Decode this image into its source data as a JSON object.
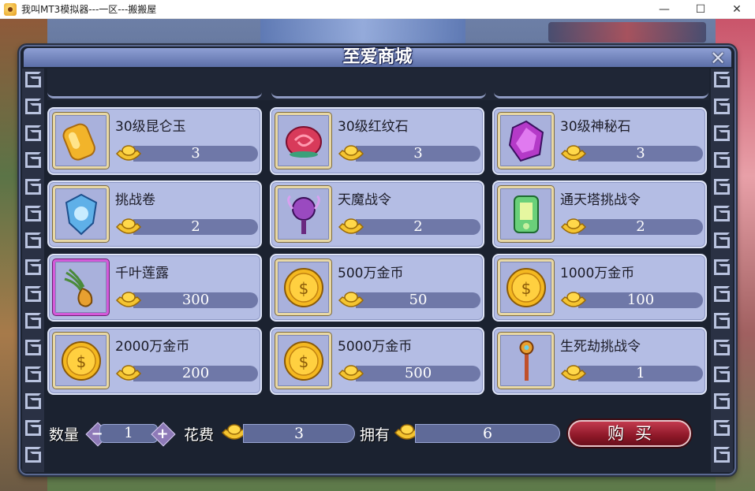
{
  "window": {
    "title": "我叫MT3模拟器---一区---搬搬屋",
    "controls": {
      "minimize": "—",
      "maximize": "☐",
      "close": "✕"
    }
  },
  "shop": {
    "title": "至爱商城",
    "close_label": "✕",
    "items": [
      {
        "name": "30级昆仑玉",
        "price": "3",
        "icon": "kunlun-jade-icon"
      },
      {
        "name": "30级红纹石",
        "price": "3",
        "icon": "red-stone-icon"
      },
      {
        "name": "30级神秘石",
        "price": "3",
        "icon": "mystery-stone-icon"
      },
      {
        "name": "挑战卷",
        "price": "2",
        "icon": "challenge-scroll-icon"
      },
      {
        "name": "天魔战令",
        "price": "2",
        "icon": "demon-token-icon"
      },
      {
        "name": "通天塔挑战令",
        "price": "2",
        "icon": "tower-token-icon"
      },
      {
        "name": "千叶莲露",
        "price": "300",
        "icon": "lotus-dew-icon"
      },
      {
        "name": "500万金币",
        "price": "50",
        "icon": "gold-coin-icon"
      },
      {
        "name": "1000万金币",
        "price": "100",
        "icon": "gold-coin-icon"
      },
      {
        "name": "2000万金币",
        "price": "200",
        "icon": "gold-coin-icon"
      },
      {
        "name": "5000万金币",
        "price": "500",
        "icon": "gold-coin-icon"
      },
      {
        "name": "生死劫挑战令",
        "price": "1",
        "icon": "life-death-token-icon"
      }
    ],
    "footer": {
      "quantity_label": "数量",
      "quantity_value": "1",
      "decrease": "−",
      "increase": "+",
      "cost_label": "花费",
      "cost_value": "3",
      "owned_label": "拥有",
      "owned_value": "6",
      "buy_label": "购买"
    }
  },
  "colors": {
    "cell_bg": "#b4bde4",
    "price_bar": "#6f78a8",
    "buy_button": "#8e1828"
  }
}
